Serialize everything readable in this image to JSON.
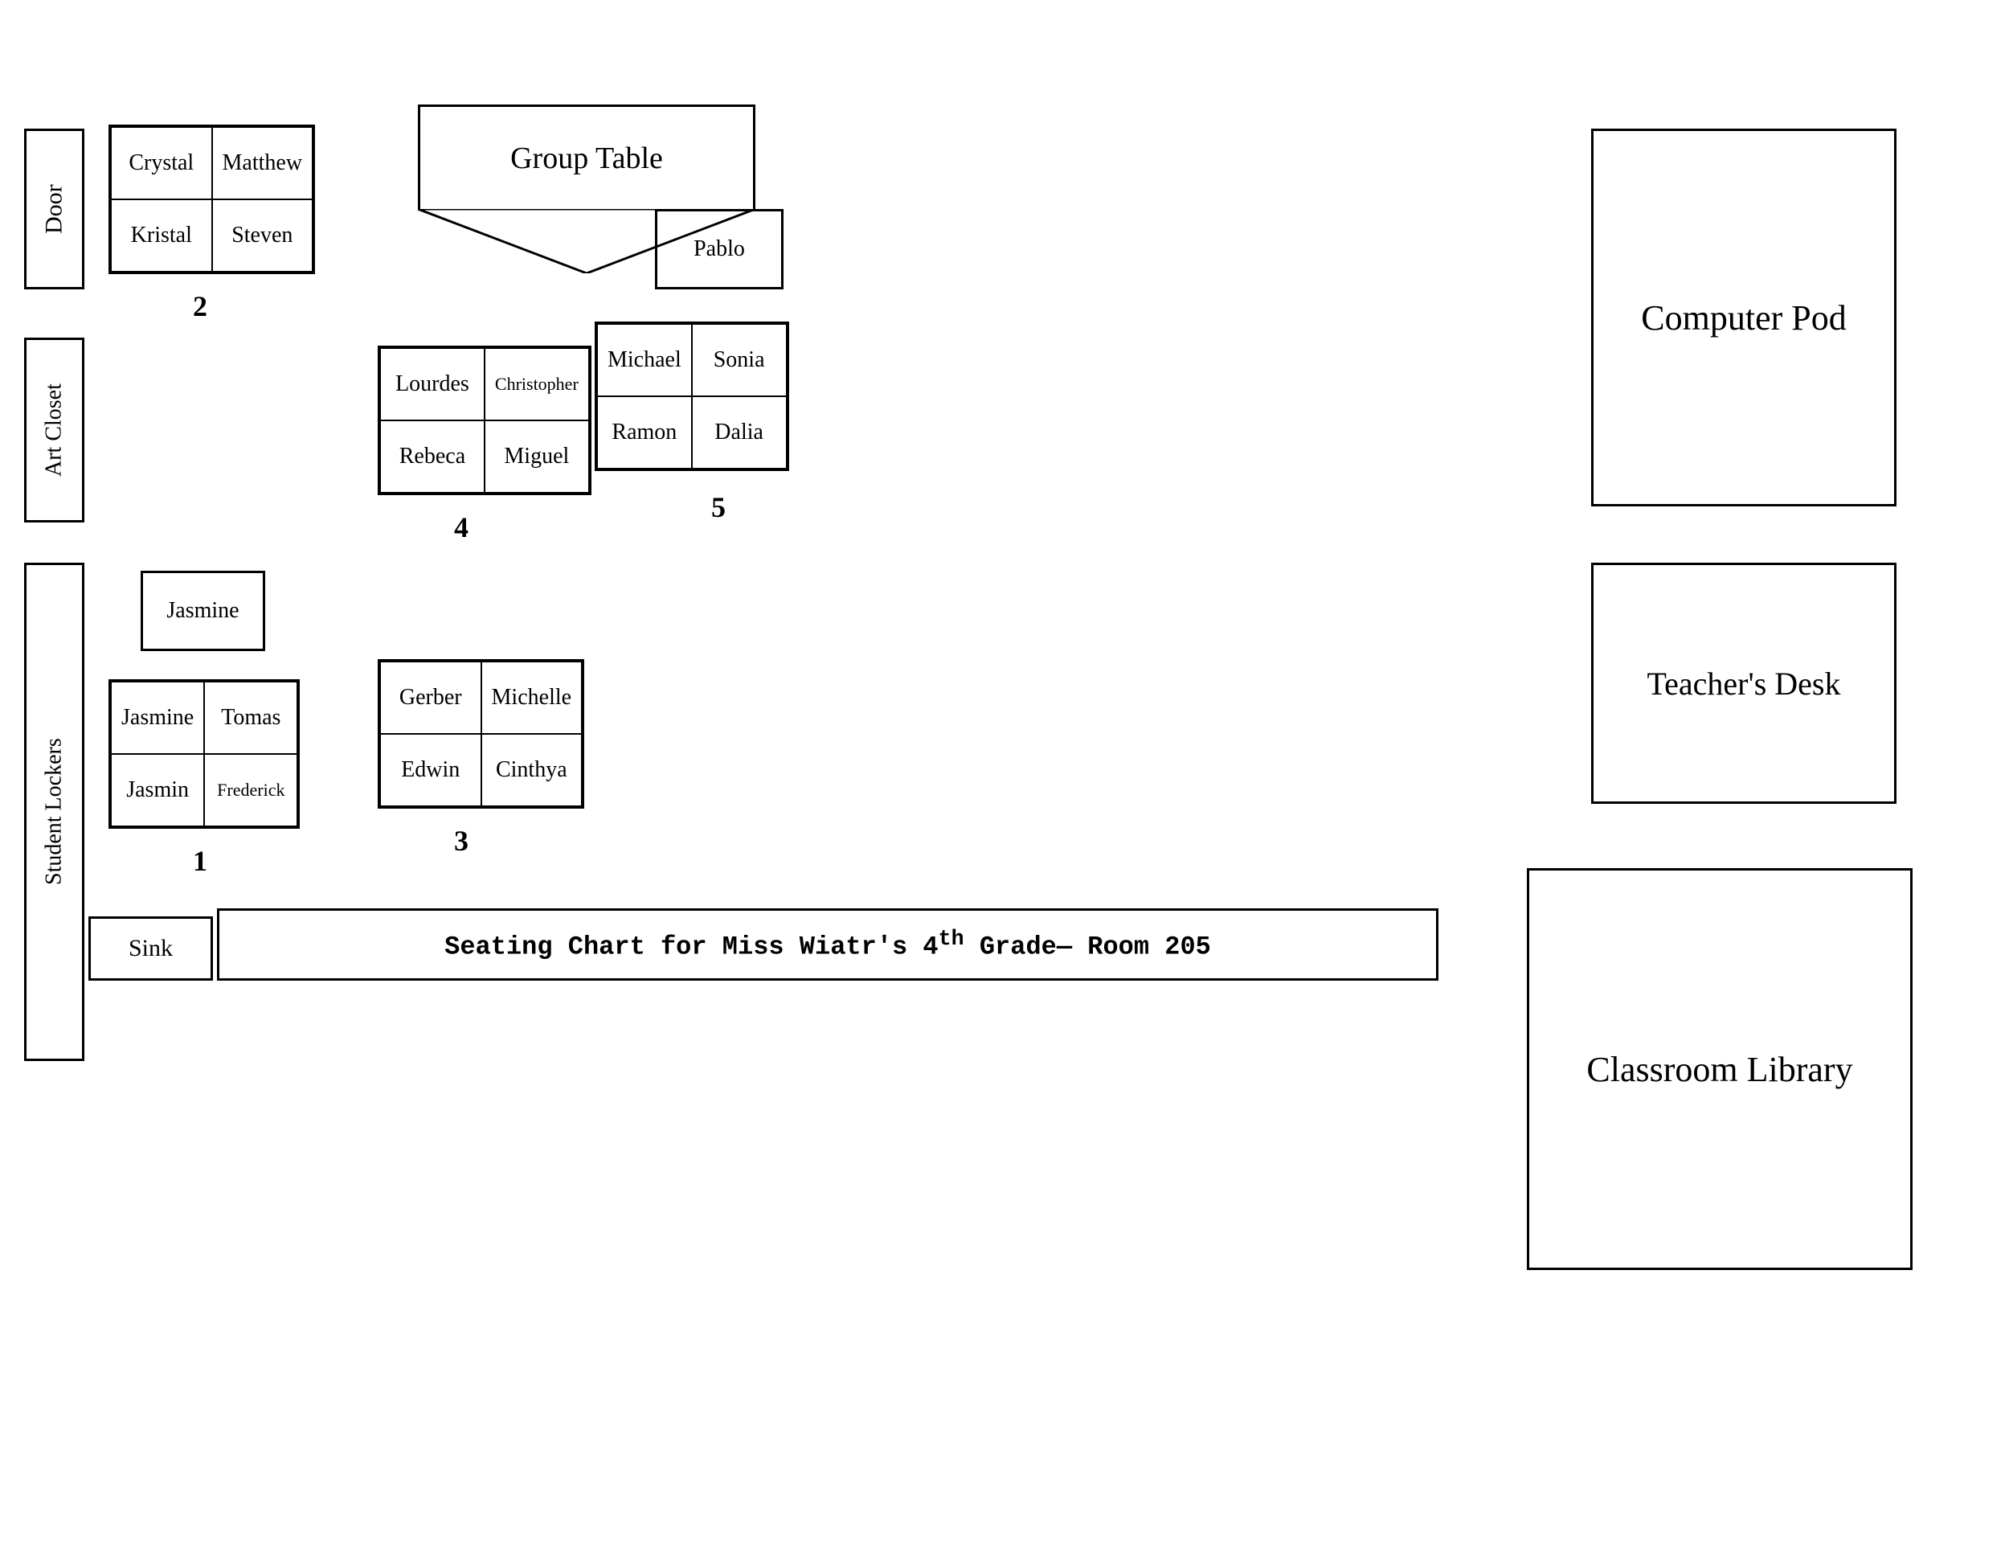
{
  "title": "Seating Chart for Miss Wiatr's 4th Grade— Room 205",
  "room_labels": {
    "door": "Door",
    "art_closet": "Art Closet",
    "student_lockers": "Student Lockers",
    "computer_pod": "Computer Pod",
    "teachers_desk": "Teacher's Desk",
    "classroom_library": "Classroom Library",
    "group_table": "Group Table",
    "sink": "Sink"
  },
  "groups": {
    "group1": {
      "number": "1",
      "top_cell": "Jasmine",
      "students": [
        "Jasmine",
        "Tomas",
        "Jasmin",
        "Frederick"
      ]
    },
    "group2": {
      "number": "2",
      "students": [
        "Crystal",
        "Matthew",
        "Kristal",
        "Steven"
      ]
    },
    "group3": {
      "number": "3",
      "students": [
        "Gerber",
        "Michelle",
        "Edwin",
        "Cinthya"
      ]
    },
    "group4": {
      "number": "4",
      "students": [
        "Lourdes",
        "Christopher",
        "Rebeca",
        "Miguel"
      ]
    },
    "group5": {
      "number": "5",
      "top_cell": "Pablo",
      "students": [
        "Michael",
        "Sonia",
        "Ramon",
        "Dalia"
      ]
    }
  }
}
